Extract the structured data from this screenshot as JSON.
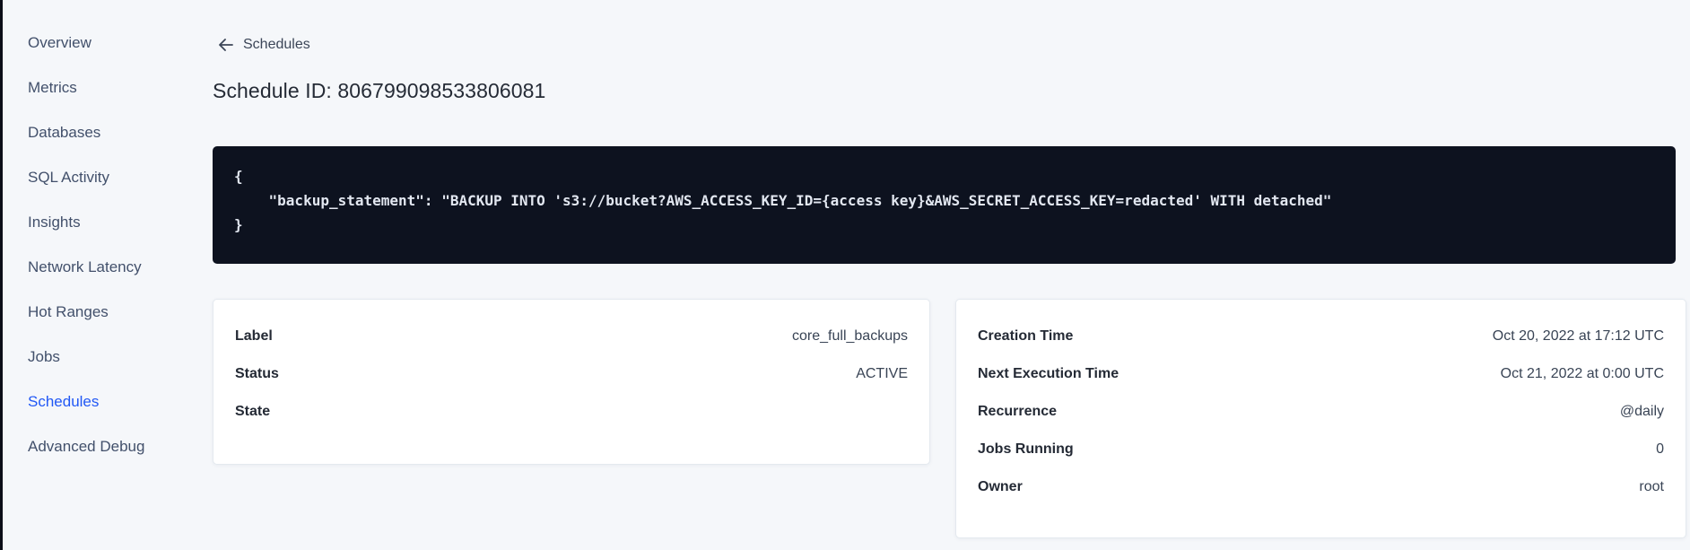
{
  "colors": {
    "background": "#f5f7fa",
    "accent_blue": "#2158f5",
    "code_background": "#0d121f",
    "sidebar_text": "#42506b",
    "card_background": "#ffffff"
  },
  "sidebar": {
    "items": [
      {
        "label": "Overview",
        "active": false
      },
      {
        "label": "Metrics",
        "active": false
      },
      {
        "label": "Databases",
        "active": false
      },
      {
        "label": "SQL Activity",
        "active": false
      },
      {
        "label": "Insights",
        "active": false
      },
      {
        "label": "Network Latency",
        "active": false
      },
      {
        "label": "Hot Ranges",
        "active": false
      },
      {
        "label": "Jobs",
        "active": false
      },
      {
        "label": "Schedules",
        "active": true
      },
      {
        "label": "Advanced Debug",
        "active": false
      }
    ]
  },
  "header": {
    "back_label": "Schedules",
    "back_icon": "arrow-left-icon",
    "title": "Schedule ID: 806799098533806081"
  },
  "code_block": {
    "lines": [
      "{",
      "    \"backup_statement\": \"BACKUP INTO 's3://bucket?AWS_ACCESS_KEY_ID={access key}&AWS_SECRET_ACCESS_KEY=redacted' WITH detached\"",
      "}"
    ]
  },
  "details_card": {
    "rows": [
      {
        "label": "Label",
        "value": "core_full_backups"
      },
      {
        "label": "Status",
        "value": "ACTIVE"
      },
      {
        "label": "State",
        "value": ""
      }
    ]
  },
  "schedule_card": {
    "rows": [
      {
        "label": "Creation Time",
        "value": "Oct 20, 2022 at 17:12 UTC"
      },
      {
        "label": "Next Execution Time",
        "value": "Oct 21, 2022 at 0:00 UTC"
      },
      {
        "label": "Recurrence",
        "value": "@daily"
      },
      {
        "label": "Jobs Running",
        "value": "0"
      },
      {
        "label": "Owner",
        "value": "root"
      }
    ]
  }
}
